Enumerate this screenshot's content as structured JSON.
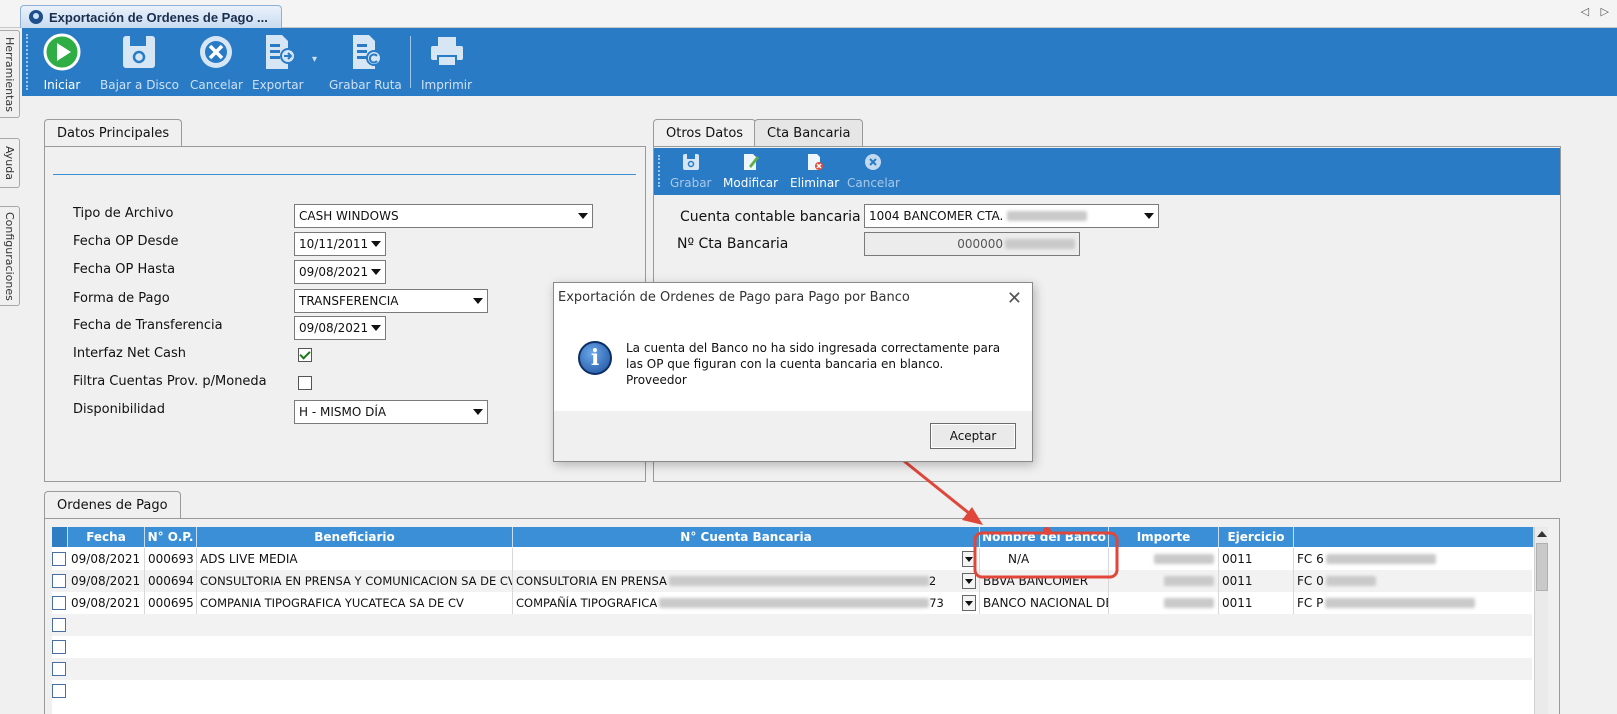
{
  "window": {
    "tab_title": "Exportación de Ordenes de Pago ...",
    "nav_arrows": "◁ ▷"
  },
  "side_tabs": [
    "Herramientas",
    "Ayuda",
    "Configuraciones"
  ],
  "toolbar": {
    "iniciar": "Iniciar",
    "bajar_disco": "Bajar a Disco",
    "cancelar": "Cancelar",
    "exportar": "Exportar",
    "grabar_ruta": "Grabar Ruta",
    "imprimir": "Imprimir"
  },
  "datos_principales": {
    "tab": "Datos Principales",
    "tipo_archivo": {
      "label": "Tipo de Archivo",
      "value": "CASH WINDOWS"
    },
    "fecha_desde": {
      "label": "Fecha OP Desde",
      "value": "10/11/2011"
    },
    "fecha_hasta": {
      "label": "Fecha OP Hasta",
      "value": "09/08/2021"
    },
    "forma_pago": {
      "label": "Forma de Pago",
      "value": "TRANSFERENCIA"
    },
    "fecha_transferencia": {
      "label": "Fecha de Transferencia",
      "value": "09/08/2021"
    },
    "interfaz_net_cash": {
      "label": "Interfaz Net Cash",
      "checked": true
    },
    "filtra_cuentas": {
      "label": "Filtra Cuentas Prov. p/Moneda",
      "checked": false
    },
    "disponibilidad": {
      "label": "Disponibilidad",
      "value": "H - MISMO DÍA"
    }
  },
  "otros_datos": {
    "tab_otros": "Otros Datos",
    "tab_cta": "Cta Bancaria",
    "toolbar": {
      "grabar": "Grabar",
      "modificar": "Modificar",
      "eliminar": "Eliminar",
      "cancelar": "Cancelar"
    },
    "cuenta_contable": {
      "label": "Cuenta contable bancaria",
      "value": "1004  BANCOMER CTA."
    },
    "nro_cta": {
      "label": "Nº Cta Bancaria",
      "value": "000000"
    }
  },
  "ordenes": {
    "tab": "Ordenes de Pago",
    "columns": [
      "Fecha",
      "N° O.P.",
      "Beneficiario",
      "N° Cuenta Bancaria",
      "Nombre del Banco",
      "Importe",
      "Ejercicio",
      ""
    ],
    "rows": [
      {
        "fecha": "09/08/2021",
        "op": "000693",
        "beneficiario": "ADS LIVE MEDIA",
        "cuenta": "",
        "banco": "N/A",
        "ejercicio": "0011",
        "extra": "FC 6"
      },
      {
        "fecha": "09/08/2021",
        "op": "000694",
        "beneficiario": "CONSULTORIA EN PRENSA Y COMUNICACION SA DE CV",
        "cuenta": "CONSULTORIA EN PRENSA",
        "cuenta_end": "2",
        "banco": "BBVA BANCOMER",
        "ejercicio": "0011",
        "extra": "FC 0"
      },
      {
        "fecha": "09/08/2021",
        "op": "000695",
        "beneficiario": "COMPANIA TIPOGRAFICA YUCATECA SA DE CV",
        "cuenta": "COMPAÑÍA TIPOGRAFICA",
        "cuenta_end": "73",
        "banco": "BANCO NACIONAL DE",
        "ejercicio": "0011",
        "extra": "FC P"
      }
    ]
  },
  "modal": {
    "title": "Exportación de Ordenes de Pago para Pago por Banco",
    "close": "✕",
    "message": [
      "La cuenta del Banco no ha sido ingresada correctamente para",
      "las OP que figuran con la cuenta bancaria en blanco.",
      "Proveedor"
    ],
    "accept": "Aceptar"
  },
  "colors": {
    "ribbon": "#2a7bc6",
    "grid_header": "#3a8fd6",
    "annotation": "#e0473a"
  }
}
